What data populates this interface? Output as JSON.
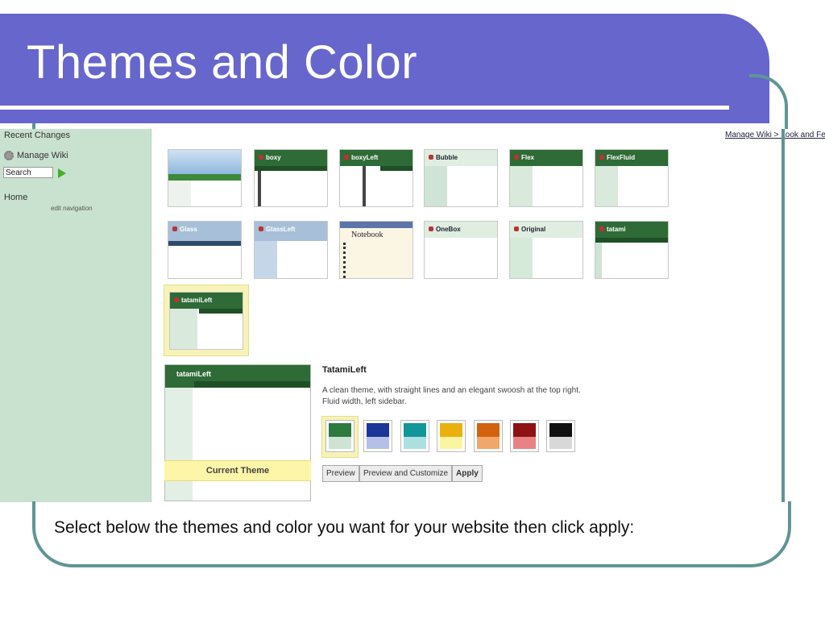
{
  "slide": {
    "title": "Themes and Color",
    "caption": "Select below the themes and color you want for your website then click apply:"
  },
  "sidebar": {
    "recent_changes": "Recent Changes",
    "manage_wiki": "Manage Wiki",
    "search_value": "Search",
    "home": "Home",
    "edit_navigation": "edit navigation"
  },
  "breadcrumb": "Manage Wiki > Look and Feel",
  "themes": [
    {
      "name": "",
      "style": "sky"
    },
    {
      "name": "boxy",
      "style": "green"
    },
    {
      "name": "boxyLeft",
      "style": "green-left"
    },
    {
      "name": "Bubble",
      "style": "light-left"
    },
    {
      "name": "Flex",
      "style": "green-left"
    },
    {
      "name": "FlexFluid",
      "style": "green-left"
    },
    {
      "name": "Glass",
      "style": "blue"
    },
    {
      "name": "GlassLeft",
      "style": "blue-left"
    },
    {
      "name": "Notebook",
      "style": "notebook"
    },
    {
      "name": "OneBox",
      "style": "light"
    },
    {
      "name": "Original",
      "style": "light-left"
    },
    {
      "name": "tatami",
      "style": "green"
    },
    {
      "name": "tatamiLeft",
      "style": "green-left"
    }
  ],
  "current": {
    "name": "TatamiLeft",
    "preview_name": "tatamiLeft",
    "label": "Current Theme",
    "description": "A clean theme, with straight lines and an elegant swoosh at the top right. Fluid width, left sidebar."
  },
  "colors": [
    {
      "top": "#2d7a3e",
      "bottom": "#cde3d3"
    },
    {
      "top": "#1a3797",
      "bottom": "#b4c0e8"
    },
    {
      "top": "#11969a",
      "bottom": "#ace0e0"
    },
    {
      "top": "#eab00d",
      "bottom": "#fbf5a0"
    },
    {
      "top": "#d2620e",
      "bottom": "#f1a66a"
    },
    {
      "top": "#8e1212",
      "bottom": "#e88284"
    },
    {
      "top": "#111111",
      "bottom": "#d8d8d8"
    }
  ],
  "buttons": {
    "preview": "Preview",
    "preview_customize": "Preview and Customize",
    "apply": "Apply"
  }
}
